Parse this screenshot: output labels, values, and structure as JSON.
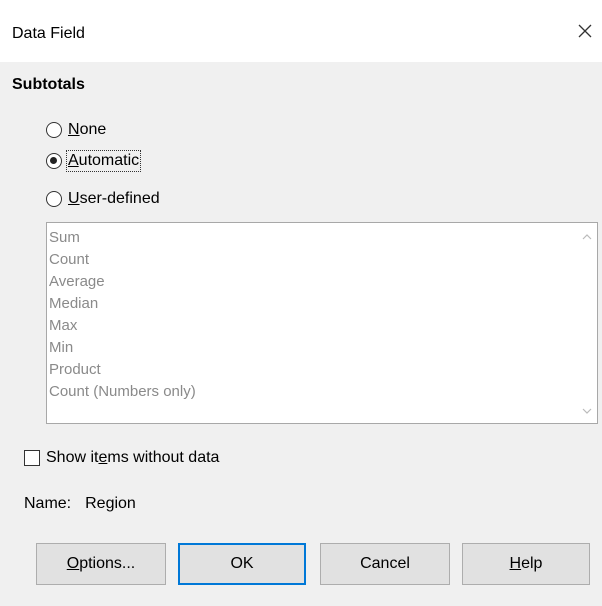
{
  "window": {
    "title": "Data Field"
  },
  "subtotals": {
    "heading": "Subtotals",
    "options": [
      {
        "pre": "",
        "mn": "N",
        "post": "one",
        "checked": false
      },
      {
        "pre": "",
        "mn": "A",
        "post": "utomatic",
        "checked": true
      },
      {
        "pre": "",
        "mn": "U",
        "post": "ser-defined",
        "checked": false
      }
    ],
    "functions": [
      "Sum",
      "Count",
      "Average",
      "Median",
      "Max",
      "Min",
      "Product",
      "Count (Numbers only)"
    ]
  },
  "show_items": {
    "pre": "Show it",
    "mn": "e",
    "post": "ms without data",
    "checked": false
  },
  "name": {
    "label": "Name:",
    "value": "Region"
  },
  "buttons": {
    "options": {
      "pre": "",
      "mn": "O",
      "post": "ptions..."
    },
    "ok": "OK",
    "cancel": "Cancel",
    "help": {
      "pre": "",
      "mn": "H",
      "post": "elp"
    }
  },
  "colors": {
    "accent": "#0078d7",
    "disabled_text": "#8a8a8a",
    "background": "#f0f0f0"
  }
}
